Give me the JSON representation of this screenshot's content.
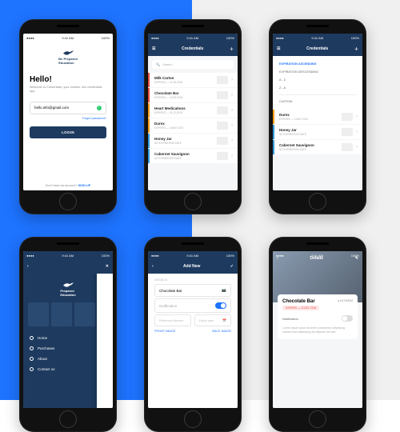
{
  "status": {
    "time": "9:41 AM",
    "batt": "100%"
  },
  "brand": {
    "line1": "Be",
    "line2": "Prepared",
    "line3": "Education"
  },
  "login": {
    "hello": "Hello!",
    "sub": "Welcome to Credentials, your number one credentials app.",
    "email": "hello.info@gmail.com",
    "btn": "LOGIN",
    "forgot": "Forgot password?",
    "noacct": "Don't have an account?",
    "signup": "SIGN UP"
  },
  "creds": {
    "title": "Credentials",
    "search": "Search",
    "items": [
      {
        "name": "Milk Carton",
        "meta": "EXPIRED — 01.08.2018",
        "bar": "bar-red"
      },
      {
        "name": "Chocolate Bar",
        "meta": "EXPIRED — 12.08.2018",
        "bar": "bar-red"
      },
      {
        "name": "Heart Medications",
        "meta": "EXPIRES — 18.12.2018",
        "bar": "bar-am"
      },
      {
        "name": "Durex",
        "meta": "EXPIRES — 4 MAY 2019",
        "bar": "bar-am"
      },
      {
        "name": "Honey Jar",
        "meta": "NO EXPIRATION DATE",
        "bar": "bar-bl"
      },
      {
        "name": "Cabernet Sauvignon",
        "meta": "NO EXPIRATION DATE",
        "bar": "bar-bl"
      }
    ]
  },
  "sort": {
    "opts": [
      "EXPIRATION ASCENDING",
      "EXPIRATION DESCENDING",
      "A - Z",
      "Z - A"
    ],
    "custom": "CUSTOM",
    "list": [
      {
        "name": "Durex",
        "meta": "EXPIRES — 4 MAY 2019",
        "bar": "bar-am"
      },
      {
        "name": "Honey Jar",
        "meta": "NO EXPIRATION DATE",
        "bar": "bar-bl"
      },
      {
        "name": "Cabernet Sauvignon",
        "meta": "NO EXPIRATION DATE",
        "bar": "bar-bl"
      }
    ]
  },
  "drawer": {
    "items": [
      "Home",
      "Purchases",
      "About",
      "Contact us"
    ]
  },
  "addnew": {
    "title": "Add New",
    "details": "DETAILS",
    "name": "Chocolate Bar",
    "noti": "Notification",
    "ref": "Reference Number",
    "expiry": "Expiry date",
    "front": "FRONT IMAGE",
    "back": "BACK IMAGE"
  },
  "details": {
    "title": "Details",
    "name": "Chocolate Bar",
    "id": "● 6173HDM",
    "pill": "EXPIRED — 12 DEC 2018",
    "noti": "Notification",
    "desc": "Lorem ipsum dolor sit amet consectetur adipiscing massa risus adipiscing dui aliquam est sed."
  }
}
